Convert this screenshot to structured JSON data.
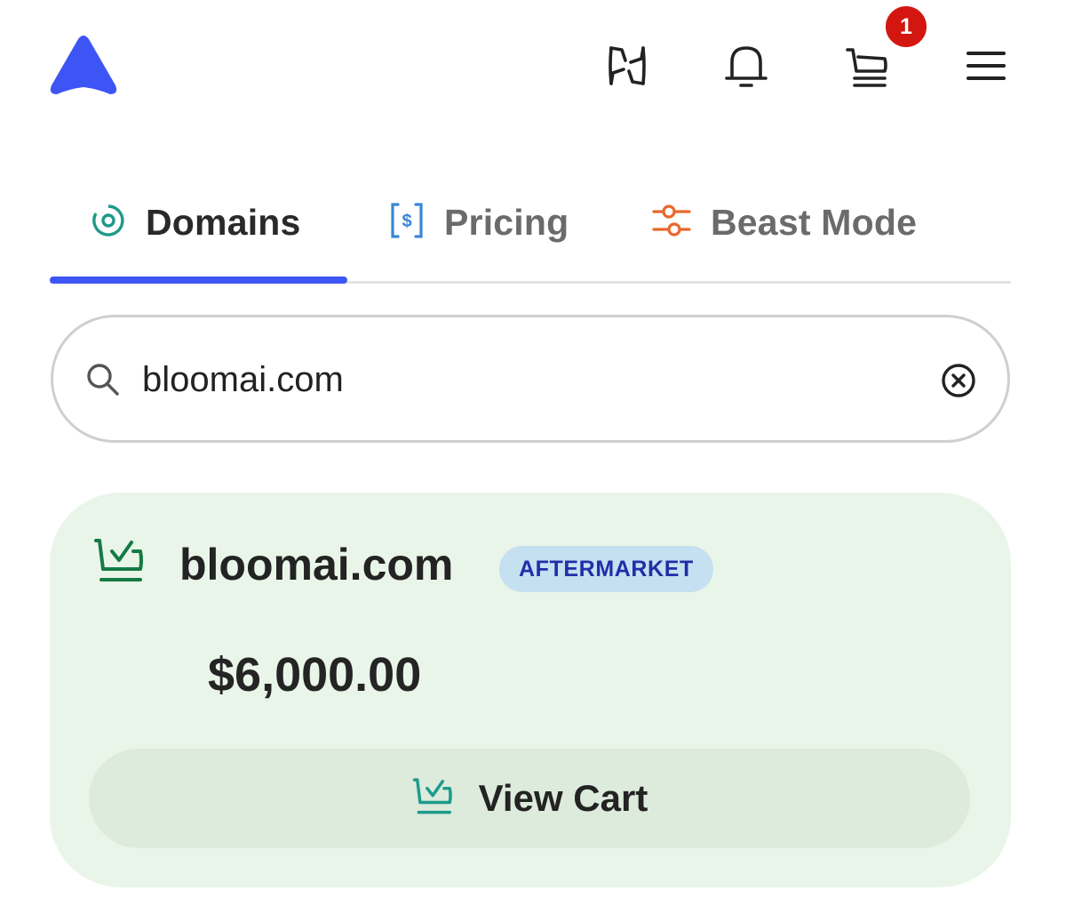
{
  "header": {
    "logo": "logo-triangle",
    "icons": [
      "ai-sparkle-icon",
      "bell-icon",
      "cart-icon",
      "menu-icon"
    ],
    "cart_count": "1",
    "accent_color": "#3d55f5",
    "badge_color": "#d3160f"
  },
  "tabs": [
    {
      "label": "Domains",
      "icon": "target-icon",
      "icon_color": "#1d9a8a",
      "active": true
    },
    {
      "label": "Pricing",
      "icon": "price-tag-icon",
      "icon_color": "#3a86d8",
      "active": false
    },
    {
      "label": "Beast Mode",
      "icon": "sliders-icon",
      "icon_color": "#e8692c",
      "active": false
    }
  ],
  "search": {
    "value": "bloomai.com",
    "placeholder": ""
  },
  "result": {
    "domain": "bloomai.com",
    "badge": "AFTERMARKET",
    "price": "$6,000.00",
    "button_label": "View Cart",
    "status_icon": "cart-check-icon",
    "card_color": "#e9f5e8"
  }
}
